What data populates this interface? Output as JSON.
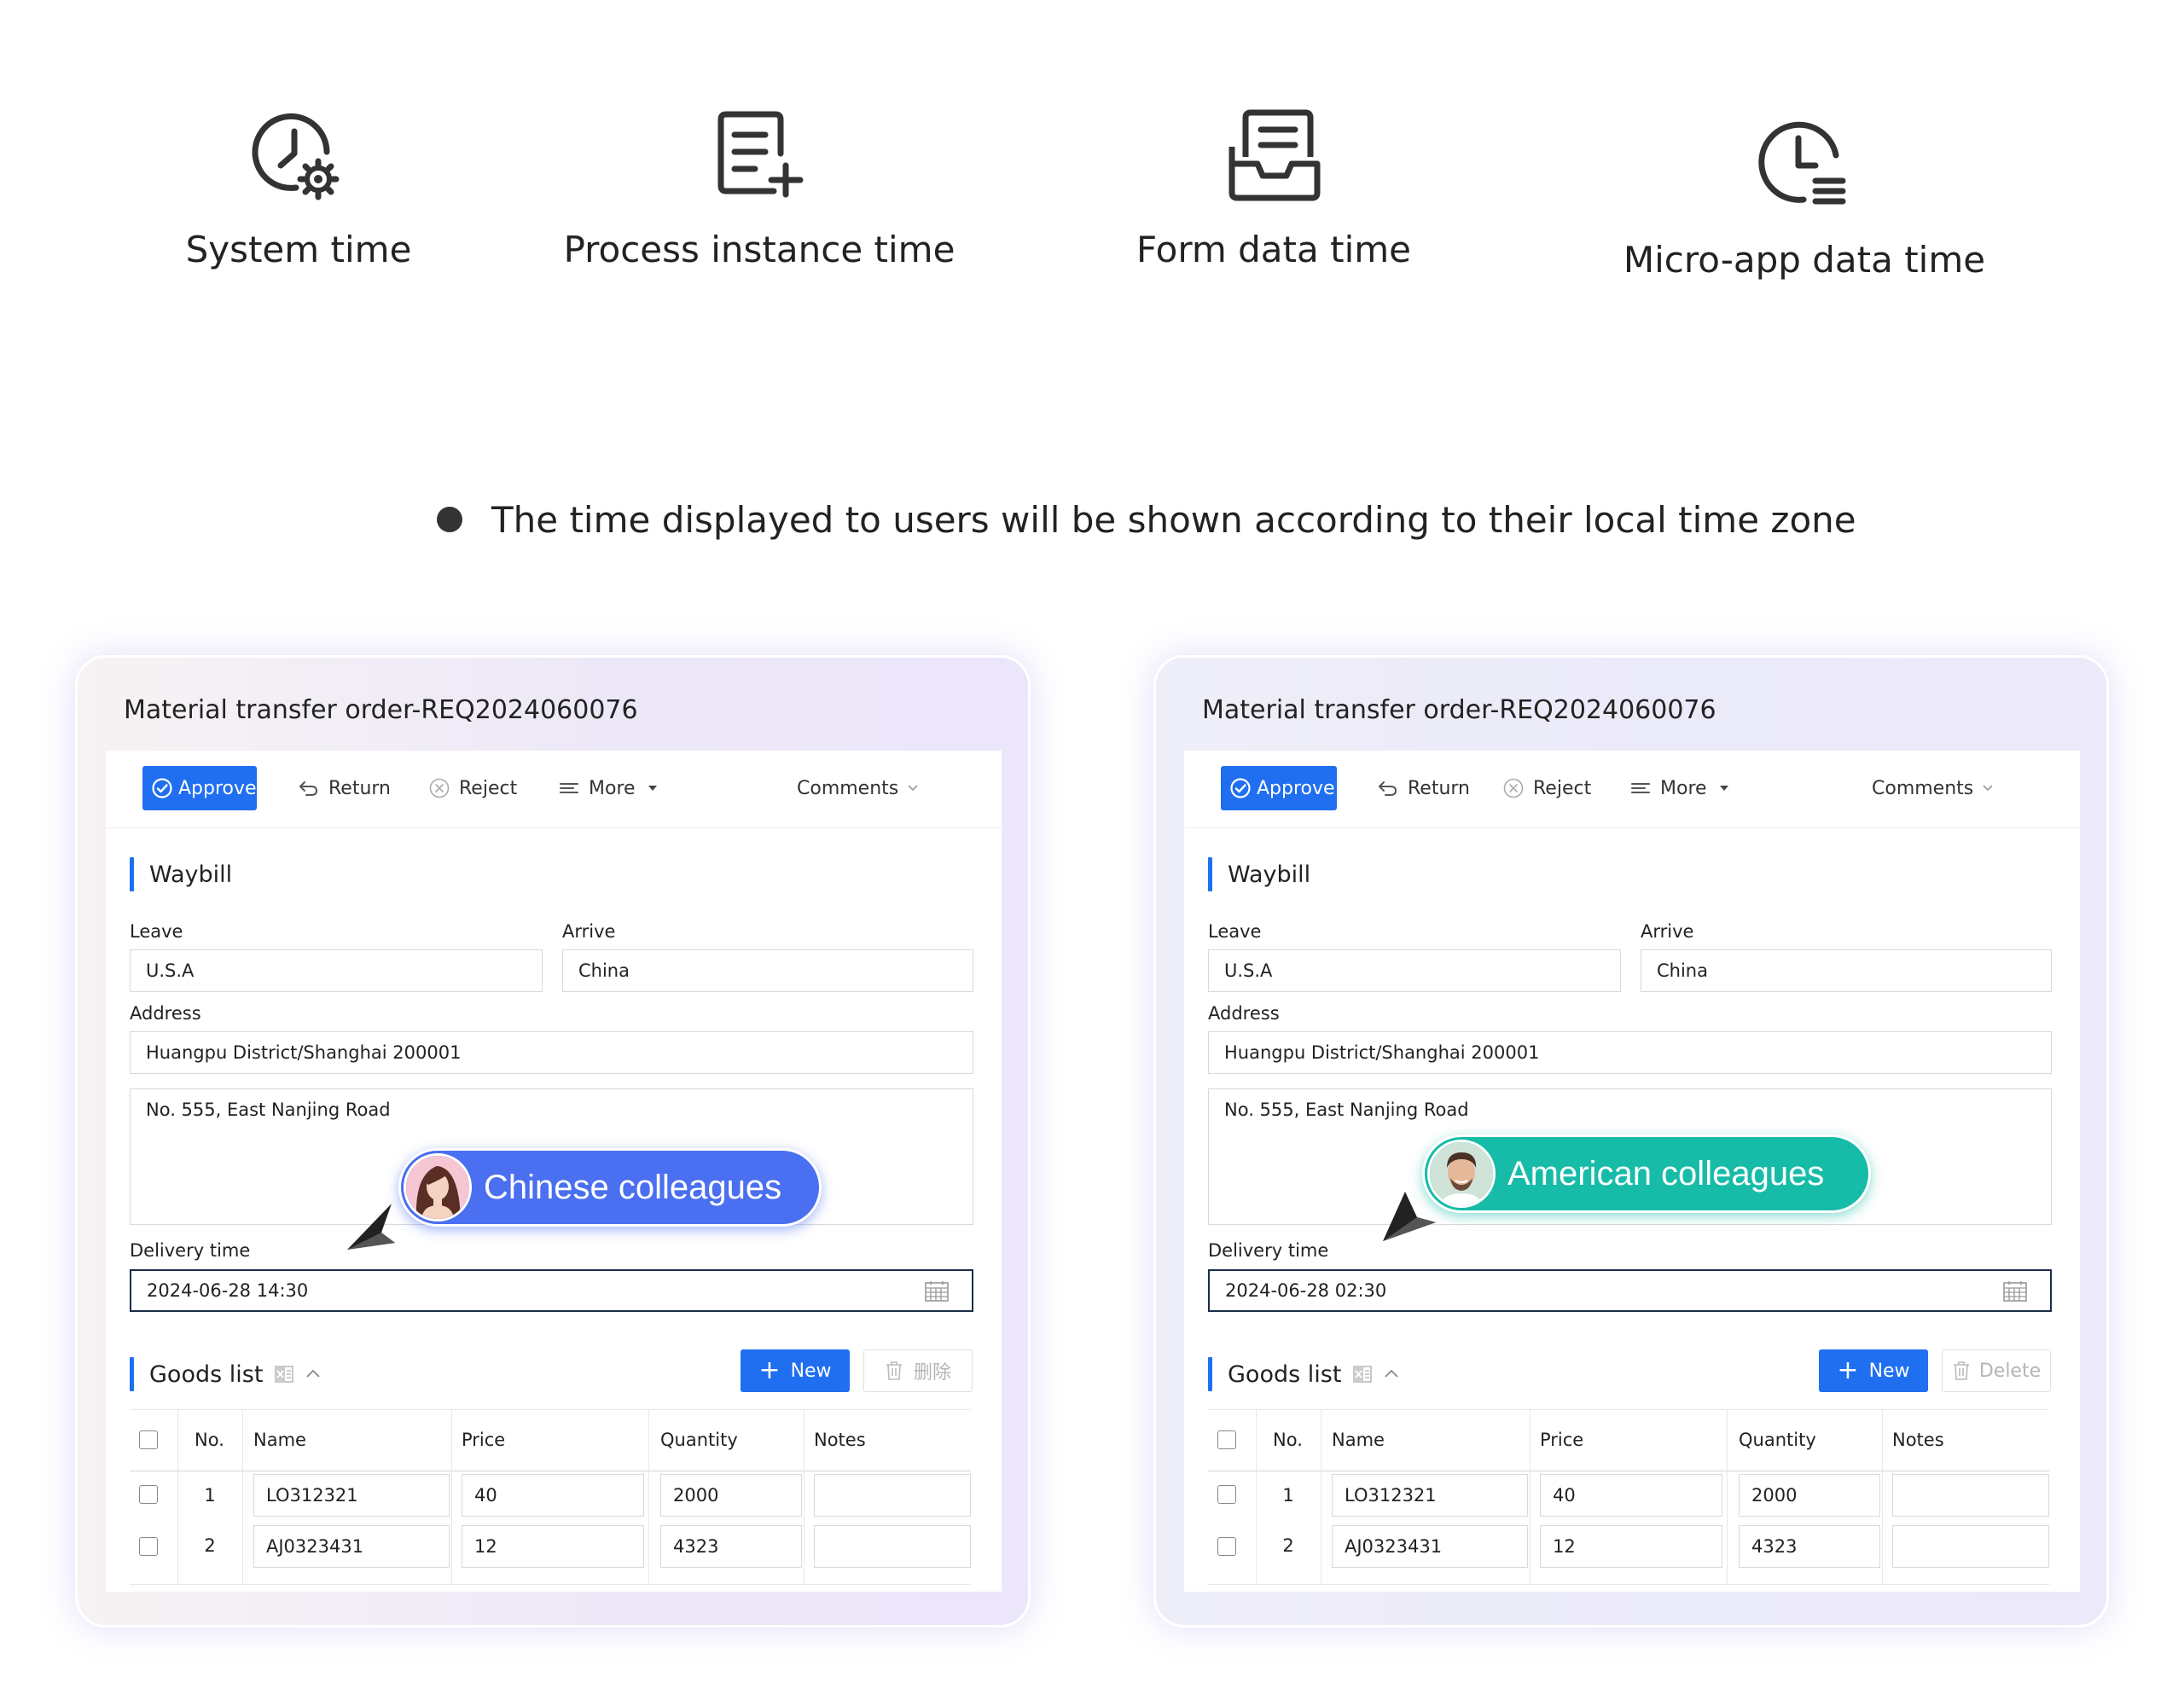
{
  "features": [
    {
      "label": "System time",
      "icon": "clock-gear-icon"
    },
    {
      "label": "Process instance time",
      "icon": "document-add-icon"
    },
    {
      "label": "Form data time",
      "icon": "form-inbox-icon"
    },
    {
      "label": "Micro-app data time",
      "icon": "clock-list-icon"
    }
  ],
  "headline": "The time displayed to users will be shown according to their local time zone",
  "panels": [
    {
      "title": "Material transfer order-REQ2024060076",
      "toolbar": {
        "approve": "Approve",
        "return": "Return",
        "reject": "Reject",
        "more": "More",
        "comments": "Comments"
      },
      "waybill": {
        "title": "Waybill",
        "leave_label": "Leave",
        "leave_value": "U.S.A",
        "arrive_label": "Arrive",
        "arrive_value": "China",
        "address_label": "Address",
        "address_value": "Huangpu District/Shanghai 200001",
        "address_detail": "No. 555, East Nanjing Road",
        "delivery_label": "Delivery time",
        "delivery_value": "2024-06-28 14:30"
      },
      "badge": "Chinese colleagues",
      "goods": {
        "title": "Goods list",
        "new": "New",
        "delete": "删除",
        "columns": [
          "No.",
          "Name",
          "Price",
          "Quantity",
          "Notes"
        ],
        "rows": [
          {
            "no": "1",
            "name": "LO312321",
            "price": "40",
            "quantity": "2000",
            "notes": ""
          },
          {
            "no": "2",
            "name": "AJ0323431",
            "price": "12",
            "quantity": "4323",
            "notes": ""
          }
        ]
      }
    },
    {
      "title": "Material transfer order-REQ2024060076",
      "toolbar": {
        "approve": "Approve",
        "return": "Return",
        "reject": "Reject",
        "more": "More",
        "comments": "Comments"
      },
      "waybill": {
        "title": "Waybill",
        "leave_label": "Leave",
        "leave_value": "U.S.A",
        "arrive_label": "Arrive",
        "arrive_value": "China",
        "address_label": "Address",
        "address_value": "Huangpu District/Shanghai 200001",
        "address_detail": "No. 555, East Nanjing Road",
        "delivery_label": "Delivery time",
        "delivery_value": "2024-06-28 02:30"
      },
      "badge": "American colleagues",
      "goods": {
        "title": "Goods list",
        "new": "New",
        "delete": "Delete",
        "columns": [
          "No.",
          "Name",
          "Price",
          "Quantity",
          "Notes"
        ],
        "rows": [
          {
            "no": "1",
            "name": "LO312321",
            "price": "40",
            "quantity": "2000",
            "notes": ""
          },
          {
            "no": "2",
            "name": "AJ0323431",
            "price": "12",
            "quantity": "4323",
            "notes": ""
          }
        ]
      }
    }
  ],
  "colors": {
    "primary": "#1f6ff0",
    "badge_cn": "#4a6ff0",
    "badge_us": "#16bca8"
  }
}
